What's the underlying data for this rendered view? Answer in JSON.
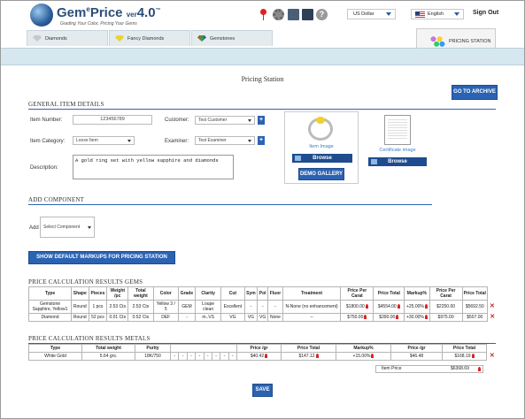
{
  "header": {
    "logo_title": "Gem",
    "logo_sup": "e",
    "logo_title2": "Price",
    "logo_ver": "ver",
    "logo_ver_num": "4.0",
    "logo_tm": "™",
    "logo_tagline": "Grading Your Color, Pricing Your Gems",
    "help_glyph": "?",
    "currency": "US Dollar",
    "language": "English",
    "signout": "Sign Out"
  },
  "tabs": [
    {
      "label": "Diamonds"
    },
    {
      "label": "Fancy Diamonds"
    },
    {
      "label": "Gemstones"
    },
    {
      "label": "PRICING STATION"
    }
  ],
  "page_title": "Pricing Station",
  "archive_button": "GO TO ARCHIVE",
  "general": {
    "heading": "GENERAL ITEM DETAILS",
    "item_number_label": "Item Number:",
    "item_number_value": "123456789",
    "customer_label": "Customer:",
    "customer_value": "Test Customer",
    "category_label": "Item Category:",
    "category_value": "Loose Item",
    "examiner_label": "Examiner:",
    "examiner_value": "Test Examiner",
    "description_label": "Description:",
    "description_value": "A gold ring set with yellow sapphire and diamonds",
    "plus": "+",
    "item_image_caption": "Item Image",
    "cert_image_caption": "Certificate image",
    "browse_label": "Browse",
    "demo_gallery": "DEMO GALLERY"
  },
  "component": {
    "heading": "ADD COMPONENT",
    "add_label": "Add",
    "select_value": "Select Component"
  },
  "markup_button": "SHOW DEFAULT MARKUPS FOR PRICING STATION",
  "gems": {
    "heading": "PRICE CALCULATION RESULTS GEMS",
    "columns": [
      "Type",
      "Shape",
      "Pieces",
      "Weight /pc",
      "Total weight",
      "Color",
      "Grade",
      "Clarity",
      "Cut",
      "Sym",
      "Pol",
      "Fluor",
      "Treatment",
      "Price Per Carat",
      "Price Total",
      "Markup%",
      "Price Per Carat",
      "Price Total"
    ],
    "rows": [
      [
        "Gemstone Sapphire, Yellow1",
        "Round",
        "1 pcs",
        "2.53 Cts",
        "2.53 Cts",
        "Yellow 3 / 5",
        "GEM",
        "Loupe clean",
        "Excellent",
        "-",
        "-",
        "-",
        "N-None (no enhancement)",
        "$1800.00",
        "$4554.00",
        "+25.00%",
        "$2250.00",
        "$5692.50"
      ],
      [
        "Diamond",
        "Round",
        "52 pcs",
        "0.01 Cts",
        "0.52 Cts",
        "DEF",
        "-",
        "m..VS",
        "VG",
        "VG",
        "VG",
        "None",
        "--",
        "$750.00",
        "$390.00",
        "+30.00%",
        "$975.00",
        "$507.00"
      ]
    ]
  },
  "metals": {
    "heading": "PRICE CALCULATION RESULTS METALS",
    "columns": [
      "Type",
      "Total weight",
      "Purity",
      "Price /gr",
      "Price Total",
      "Markup%",
      "Price /gr",
      "Price Total"
    ],
    "rows": [
      [
        "White Gold",
        "5.64 grs.",
        "18K/750",
        "$40.42",
        "$147.12",
        "+15.00%",
        "$46.48",
        "$168.19"
      ]
    ],
    "dash": "-",
    "item_price_label": "Item Price",
    "item_price_value": "$6368.69"
  },
  "save_button": "SAVE"
}
